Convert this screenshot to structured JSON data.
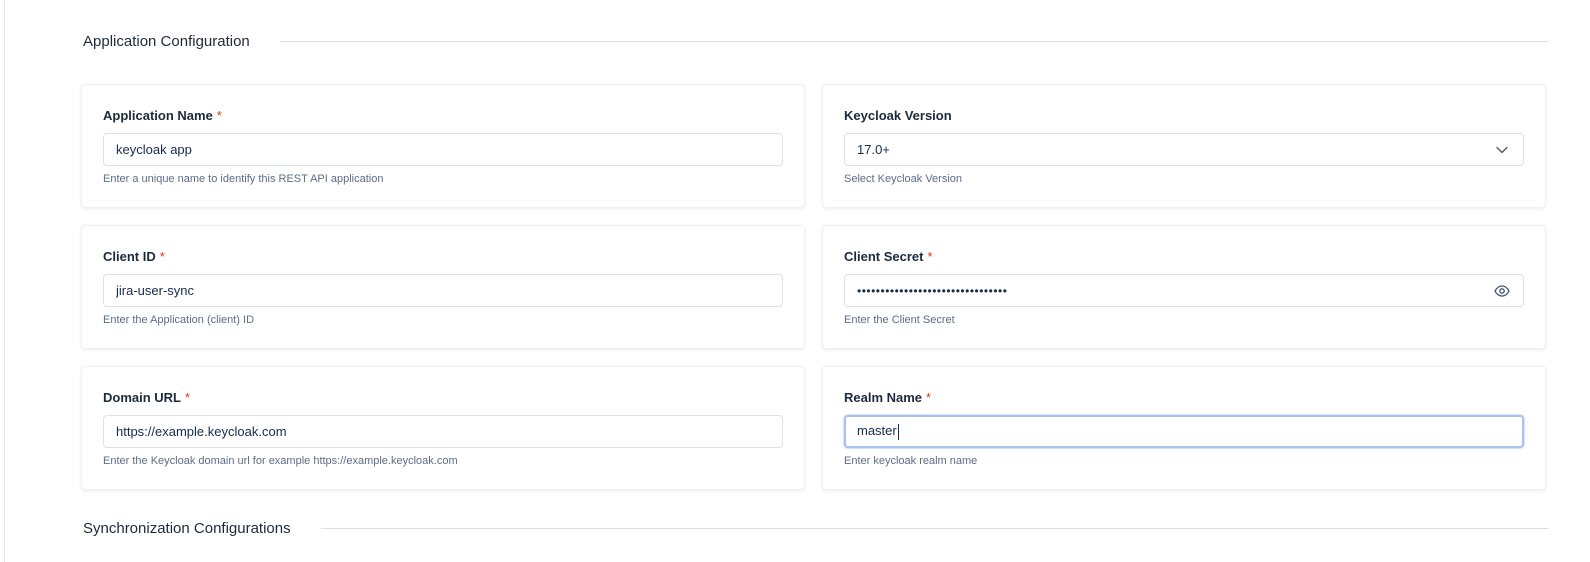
{
  "sections": {
    "application_configuration": "Application Configuration",
    "synchronization_configurations": "Synchronization Configurations"
  },
  "required_marker": "*",
  "fields": {
    "application_name": {
      "label": "Application Name",
      "value": "keycloak app",
      "help": "Enter a unique name to identify this REST API application"
    },
    "keycloak_version": {
      "label": "Keycloak Version",
      "value": "17.0+",
      "help": "Select Keycloak Version"
    },
    "client_id": {
      "label": "Client ID",
      "value": "jira-user-sync",
      "help": "Enter the Application (client) ID"
    },
    "client_secret": {
      "label": "Client Secret",
      "value": "••••••••••••••••••••••••••••••••",
      "help": "Enter the Client Secret"
    },
    "domain_url": {
      "label": "Domain URL",
      "value": "https://example.keycloak.com",
      "help": "Enter the Keycloak domain url for example https://example.keycloak.com"
    },
    "realm_name": {
      "label": "Realm Name",
      "value": "master",
      "help": "Enter keycloak realm name"
    }
  },
  "icons": {
    "dropdown": "chevron-down-icon",
    "reveal_secret": "eye-icon"
  },
  "colors": {
    "required": "#de350b",
    "focus_border": "#a9c2ef",
    "help_text": "#5e6c84"
  }
}
